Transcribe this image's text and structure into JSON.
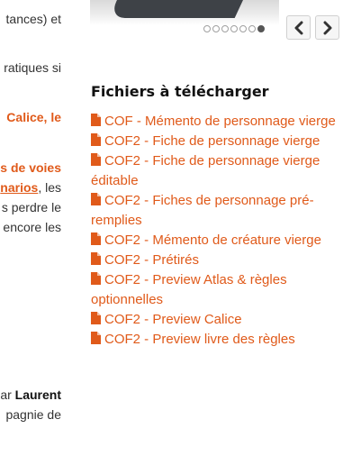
{
  "left_column": {
    "lines": [
      {
        "text": "tances) et",
        "style": "normal"
      },
      {
        "text": "ratiques si",
        "style": "normal"
      },
      {
        "text": "Calice, le",
        "style": "orange"
      },
      {
        "text": "s de voies",
        "style": "orange"
      },
      {
        "text_link": "narios",
        "text_after": ", les",
        "style": "mixed"
      },
      {
        "text": "s perdre le",
        "style": "normal"
      },
      {
        "text": "encore les",
        "style": "normal"
      },
      {
        "text_before": "ar ",
        "text_bold": "Laurent",
        "style": "mixed-bold"
      },
      {
        "text": "pagnie de",
        "style": "normal"
      }
    ]
  },
  "carousel": {
    "dot_count": 7,
    "active_dot": 7,
    "prev_icon": "chevron-left-icon",
    "next_icon": "chevron-right-icon"
  },
  "downloads": {
    "title": "Fichiers à télécharger",
    "icon": "file-icon",
    "accent_color": "#e05a1a",
    "files": [
      {
        "label": "COF - Mémento de personnage vierge"
      },
      {
        "label": "COF2 - Fiche de personnage vierge"
      },
      {
        "label": "COF2 - Fiche de personnage vierge éditable"
      },
      {
        "label": "COF2 - Fiches de personnage pré-remplies"
      },
      {
        "label": "COF2 - Mémento de créature vierge"
      },
      {
        "label": "COF2 - Prétirés"
      },
      {
        "label": "COF2 - Preview Atlas & règles optionnelles"
      },
      {
        "label": "COF2 - Preview Calice"
      },
      {
        "label": "COF2 - Preview livre des règles"
      }
    ]
  }
}
